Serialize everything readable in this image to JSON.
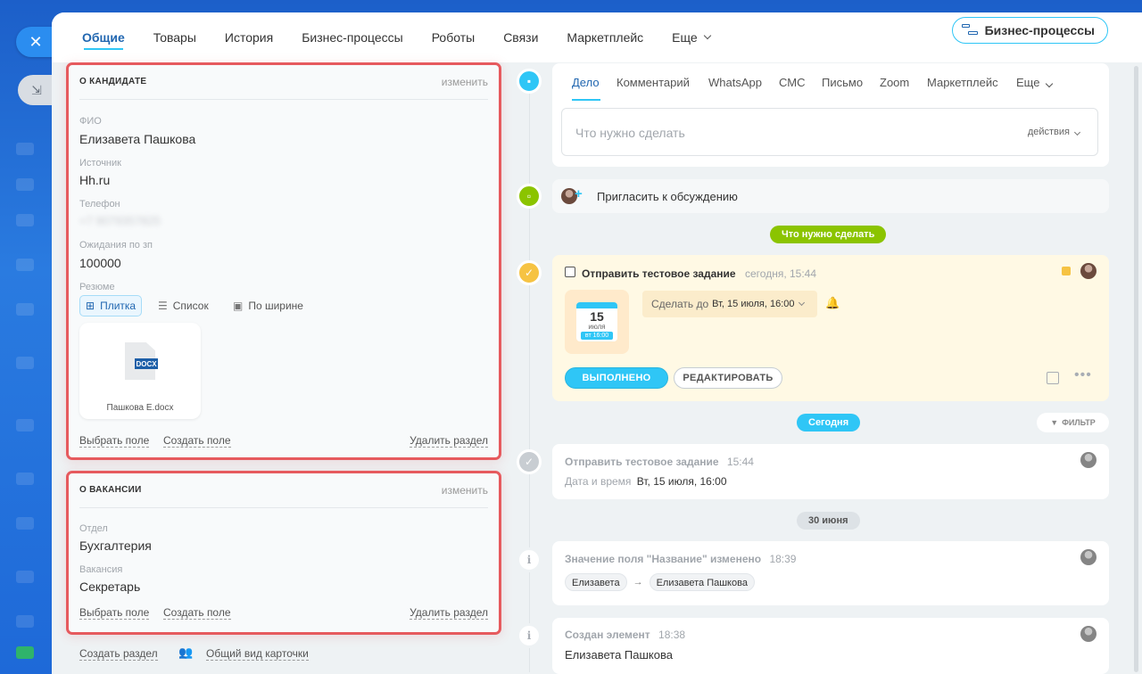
{
  "nav": {
    "tabs": [
      "Общие",
      "Товары",
      "История",
      "Бизнес-процессы",
      "Роботы",
      "Связи",
      "Маркетплейс",
      "Еще"
    ],
    "bp_button": "Бизнес-процессы"
  },
  "candidate": {
    "title": "О КАНДИДАТЕ",
    "edit": "изменить",
    "fio_label": "ФИО",
    "fio_value": "Елизавета Пашкова",
    "source_label": "Источник",
    "source_value": "Hh.ru",
    "phone_label": "Телефон",
    "phone_value": "+7 9079357825",
    "salary_label": "Ожидания по зп",
    "salary_value": "100000",
    "resume_label": "Резюме",
    "view_tile": "Плитка",
    "view_list": "Список",
    "view_wide": "По ширине",
    "file_badge": "DOCX",
    "file_name": "Пашкова Е.docx",
    "choose_field": "Выбрать поле",
    "create_field": "Создать поле",
    "delete_section": "Удалить раздел"
  },
  "vacancy": {
    "title": "О ВАКАНСИИ",
    "edit": "изменить",
    "dept_label": "Отдел",
    "dept_value": "Бухгалтерия",
    "vac_label": "Вакансия",
    "vac_value": "Секретарь",
    "choose_field": "Выбрать поле",
    "create_field": "Создать поле",
    "delete_section": "Удалить раздел"
  },
  "bottom_links": {
    "create_section": "Создать раздел",
    "general_view": "Общий вид карточки"
  },
  "editor": {
    "tabs": [
      "Дело",
      "Комментарий",
      "WhatsApp",
      "СМС",
      "Письмо",
      "Zoom",
      "Маркетплейс",
      "Еще"
    ],
    "placeholder": "Что нужно сделать",
    "actions": "действия"
  },
  "invite": "Пригласить к обсуждению",
  "todo_badge": "Что нужно сделать",
  "task": {
    "title": "Отправить тестовое задание",
    "time": "сегодня, 15:44",
    "cal_day": "15",
    "cal_month": "июля",
    "cal_weekday": "вт 16:00",
    "deadline_prefix": "Сделать до",
    "deadline_value": "Вт, 15 июля, 16:00",
    "done_button": "ВЫПОЛНЕНО",
    "edit_button": "РЕДАКТИРОВАТЬ"
  },
  "today_badge": "Сегодня",
  "filter": "ФИЛЬТР",
  "history1": {
    "title": "Отправить тестовое задание",
    "time": "15:44",
    "label": "Дата и время",
    "value": "Вт, 15 июля, 16:00"
  },
  "date_badge": "30 июня",
  "history2": {
    "title": "Значение поля \"Название\" изменено",
    "time": "18:39",
    "from": "Елизавета",
    "to": "Елизавета Пашкова"
  },
  "history3": {
    "title": "Создан элемент",
    "time": "18:38",
    "value": "Елизавета Пашкова"
  },
  "colors": {
    "accent": "#2fc6f6",
    "highlight_border": "#e65a5e",
    "todo_green": "#8bc400",
    "task_bg": "#fff9e4"
  }
}
